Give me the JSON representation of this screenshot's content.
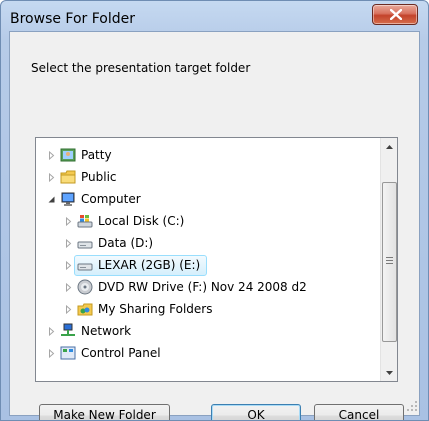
{
  "dialog": {
    "title": "Browse For Folder",
    "prompt": "Select the presentation target folder"
  },
  "tree": {
    "items": [
      {
        "label": "Patty",
        "icon": "user-folder-icon",
        "expander": "collapsed"
      },
      {
        "label": "Public",
        "icon": "folder-icon",
        "expander": "collapsed"
      },
      {
        "label": "Computer",
        "icon": "computer-icon",
        "expander": "expanded"
      },
      {
        "label": "Local Disk (C:)",
        "icon": "windows-drive-icon",
        "expander": "collapsed"
      },
      {
        "label": "Data (D:)",
        "icon": "hard-drive-icon",
        "expander": "collapsed"
      },
      {
        "label": "LEXAR (2GB) (E:)",
        "icon": "removable-drive-icon",
        "expander": "collapsed",
        "selected": true
      },
      {
        "label": "DVD RW Drive (F:) Nov 24 2008 d2",
        "icon": "dvd-drive-icon",
        "expander": "collapsed"
      },
      {
        "label": "My Sharing Folders",
        "icon": "sharing-folder-icon",
        "expander": "collapsed"
      },
      {
        "label": "Network",
        "icon": "network-icon",
        "expander": "collapsed"
      },
      {
        "label": "Control Panel",
        "icon": "control-panel-icon",
        "expander": "collapsed"
      }
    ]
  },
  "buttons": {
    "make_new_folder": "Make New Folder",
    "ok": "OK",
    "cancel": "Cancel"
  },
  "colors": {
    "selection_border": "#99defd",
    "selection_fill": "#d5effc",
    "close_button": "#c3432b",
    "title_bar": "#b6cbe8"
  }
}
